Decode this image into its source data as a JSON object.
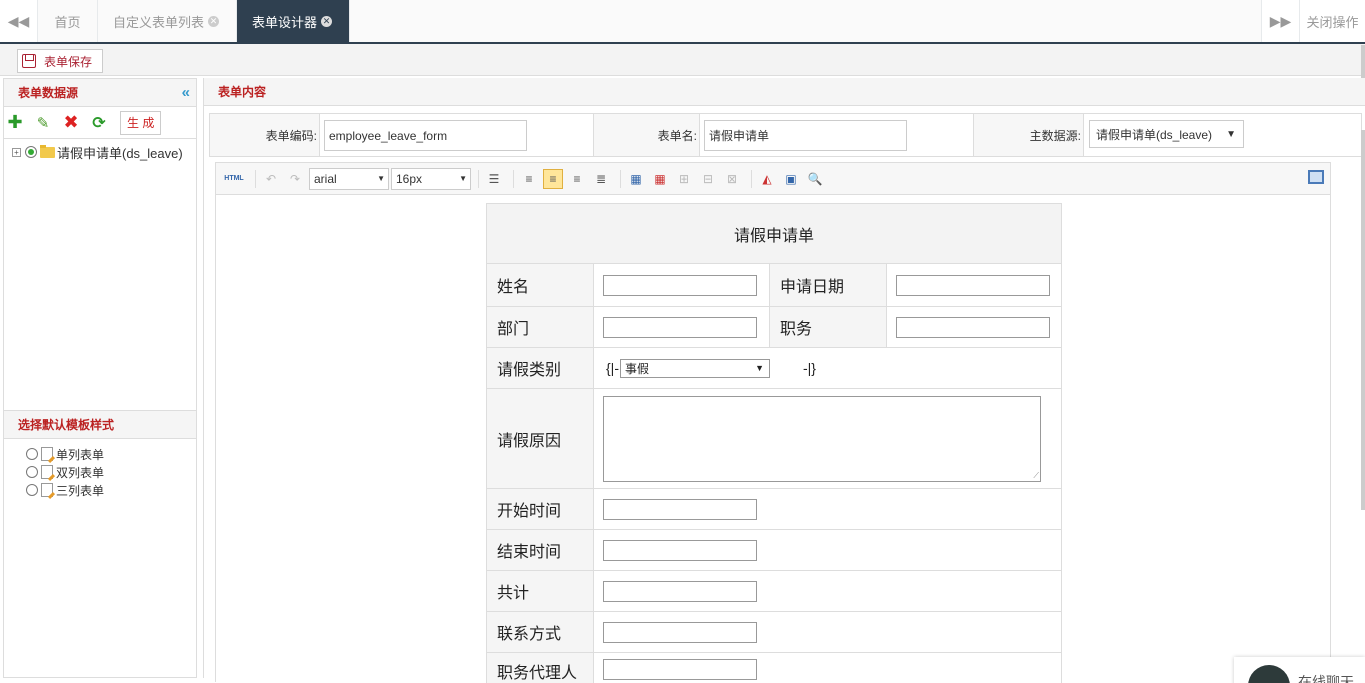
{
  "tabs": {
    "home": "首页",
    "form_list": "自定义表单列表",
    "designer": "表单设计器",
    "close_ops": "关闭操作"
  },
  "toolbar": {
    "save_label": "表单保存"
  },
  "left": {
    "datasource_title": "表单数据源",
    "generate_label": "生 成",
    "tree_item": "请假申请单(ds_leave)",
    "template_title": "选择默认模板样式",
    "templates": [
      "单列表单",
      "双列表单",
      "三列表单"
    ]
  },
  "right": {
    "title": "表单内容",
    "code_label": "表单编码:",
    "code_value": "employee_leave_form",
    "name_label": "表单名:",
    "name_value": "请假申请单",
    "ds_label": "主数据源:",
    "ds_value": "请假申请单(ds_leave)"
  },
  "editor": {
    "html_btn": "HTML",
    "font_family": "arial",
    "font_size": "16px"
  },
  "form": {
    "title": "请假申请单",
    "name": "姓名",
    "apply_date": "申请日期",
    "dept": "部门",
    "position": "职务",
    "leave_type": "请假类别",
    "leave_type_prefix": "{|-",
    "leave_type_value": "事假",
    "leave_type_suffix": "-|}",
    "reason": "请假原因",
    "start_time": "开始时间",
    "end_time": "结束时间",
    "total": "共计",
    "contact": "联系方式",
    "agent": "职务代理人"
  },
  "chat": {
    "label": "在线聊天"
  }
}
